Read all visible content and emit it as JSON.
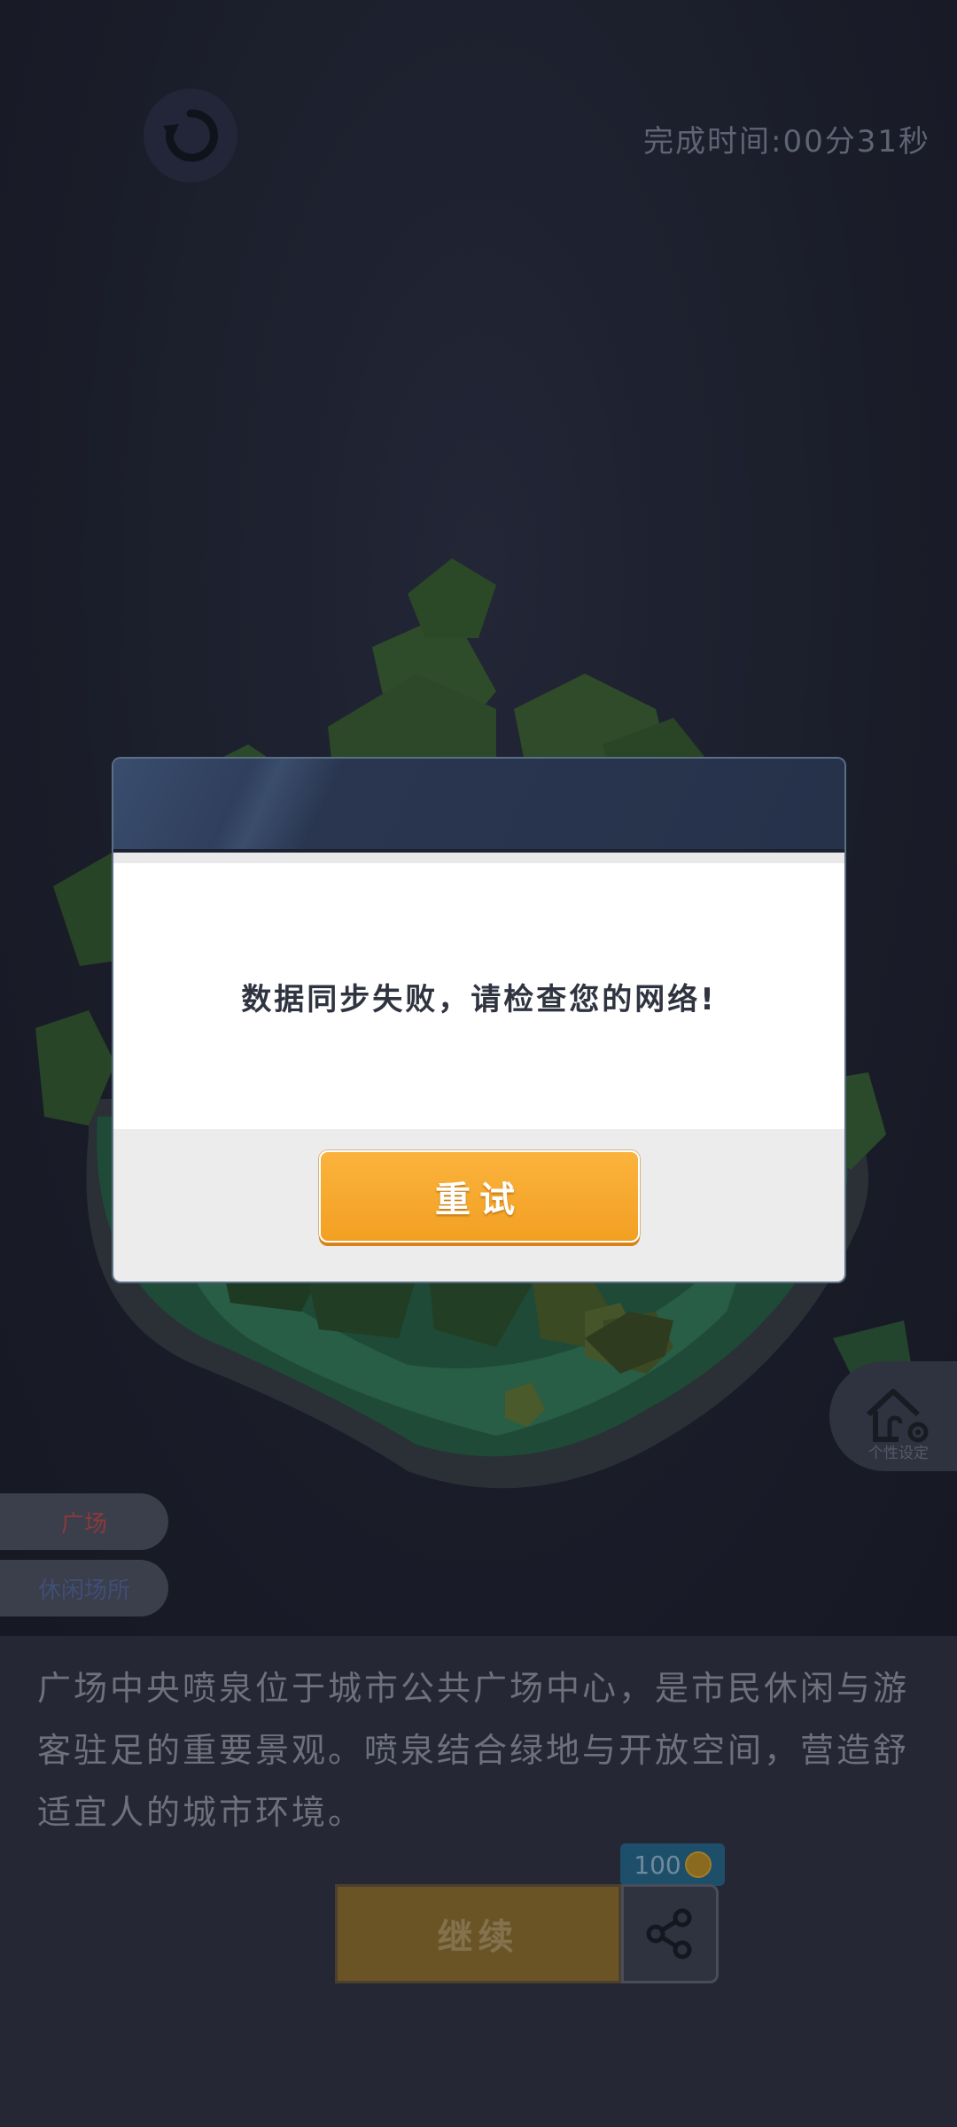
{
  "header": {
    "restart_icon": "refresh-icon",
    "timer_label": "完成时间:",
    "timer_minutes": "00",
    "timer_minutes_unit": "分",
    "timer_seconds": "31",
    "timer_seconds_unit": "秒"
  },
  "tags": {
    "plaza": "广场",
    "leisure": "休闲场所"
  },
  "settings": {
    "icon": "house-gear-icon",
    "label": "个性设定"
  },
  "description": "广场中央喷泉位于城市公共广场中心，是市民休闲与游客驻足的重要景观。喷泉结合绿地与开放空间，营造舒适宜人的城市环境。",
  "actions": {
    "continue_label": "继续",
    "share_icon": "share-icon",
    "coin_amount": "100",
    "coin_icon": "coin-icon"
  },
  "dialog": {
    "message": "数据同步失败，请检查您的网络!",
    "retry_label": "重试"
  },
  "colors": {
    "accent_orange": "#f7a92c",
    "dialog_header": "#2d3b57",
    "background": "#1b1d27"
  }
}
